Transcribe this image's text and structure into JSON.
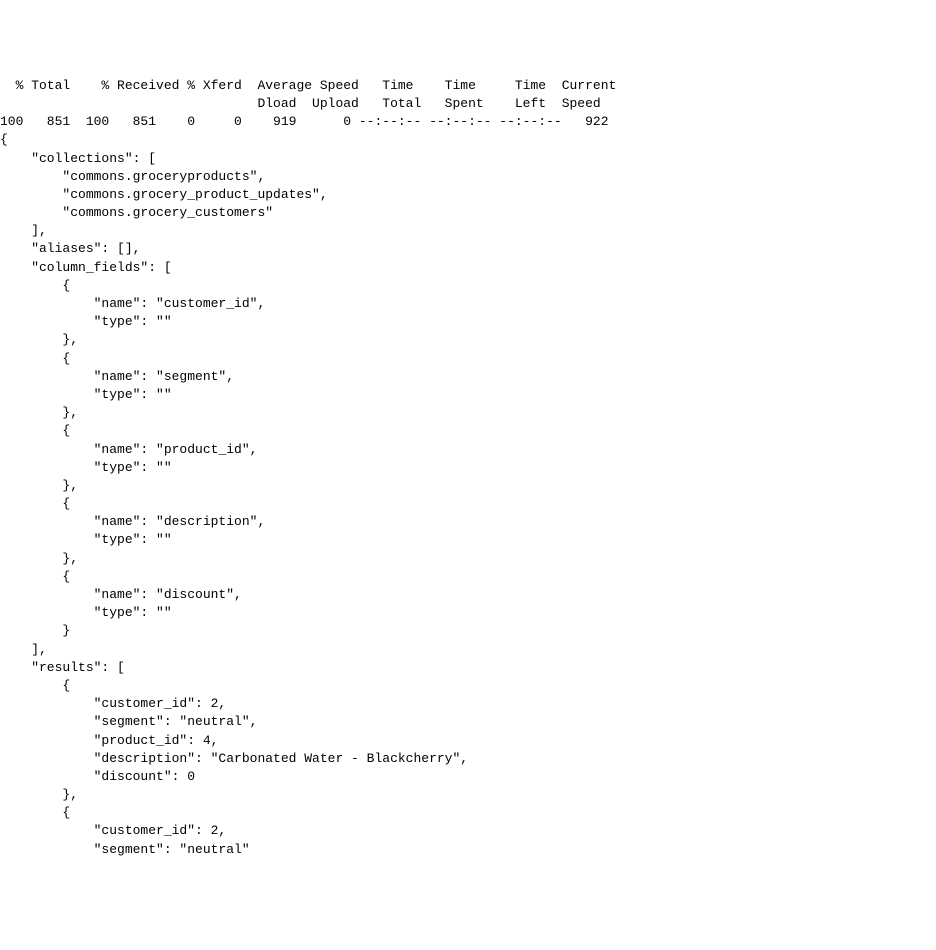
{
  "curl_header": {
    "line1": "  % Total    % Received % Xferd  Average Speed   Time    Time     Time  Current",
    "line2": "                                 Dload  Upload   Total   Spent    Left  Speed",
    "line3": "100   851  100   851    0     0    919      0 --:--:-- --:--:-- --:--:--   922"
  },
  "json_body": {
    "open_brace": "{",
    "collections_key": "    \"collections\": [",
    "collection_1": "        \"commons.groceryproducts\",",
    "collection_2": "        \"commons.grocery_product_updates\",",
    "collection_3": "        \"commons.grocery_customers\"",
    "collections_close": "    ],",
    "aliases": "    \"aliases\": [],",
    "column_fields_key": "    \"column_fields\": [",
    "cf1_open": "        {",
    "cf1_name": "            \"name\": \"customer_id\",",
    "cf1_type": "            \"type\": \"\"",
    "cf1_close": "        },",
    "cf2_open": "        {",
    "cf2_name": "            \"name\": \"segment\",",
    "cf2_type": "            \"type\": \"\"",
    "cf2_close": "        },",
    "cf3_open": "        {",
    "cf3_name": "            \"name\": \"product_id\",",
    "cf3_type": "            \"type\": \"\"",
    "cf3_close": "        },",
    "cf4_open": "        {",
    "cf4_name": "            \"name\": \"description\",",
    "cf4_type": "            \"type\": \"\"",
    "cf4_close": "        },",
    "cf5_open": "        {",
    "cf5_name": "            \"name\": \"discount\",",
    "cf5_type": "            \"type\": \"\"",
    "cf5_close": "        }",
    "column_fields_close": "    ],",
    "results_key": "    \"results\": [",
    "r1_open": "        {",
    "r1_customer_id": "            \"customer_id\": 2,",
    "r1_segment": "            \"segment\": \"neutral\",",
    "r1_product_id": "            \"product_id\": 4,",
    "r1_description": "            \"description\": \"Carbonated Water - Blackcherry\",",
    "r1_discount": "            \"discount\": 0",
    "r1_close": "        },",
    "r2_open": "        {",
    "r2_customer_id": "            \"customer_id\": 2,",
    "r2_segment": "            \"segment\": \"neutral\""
  }
}
